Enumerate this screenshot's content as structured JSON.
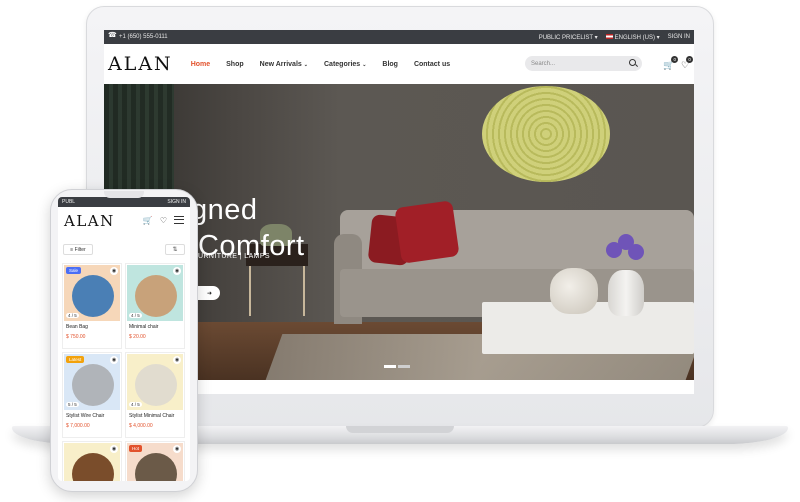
{
  "desktop": {
    "topbar": {
      "phone": "+1 (650) 555-0111",
      "pricelist": "PUBLIC PRICELIST",
      "language": "ENGLISH (US)",
      "signin": "SIGN IN"
    },
    "logo": "ALAN",
    "menu": [
      {
        "label": "Home",
        "active": true
      },
      {
        "label": "Shop"
      },
      {
        "label": "New Arrivals",
        "dropdown": true
      },
      {
        "label": "Categories",
        "dropdown": true
      },
      {
        "label": "Blog"
      },
      {
        "label": "Contact us"
      }
    ],
    "search_placeholder": "Search...",
    "cart_count": "0",
    "wishlist_count": "0",
    "hero": {
      "title_line1": "Designed",
      "title_line2": "your Comfort",
      "subtitle": "URNITURE  |  LAMPS",
      "slide_count": 2,
      "active_slide": 1
    }
  },
  "mobile": {
    "topbar_left": "PUBL",
    "topbar_right": "SIGN IN",
    "logo": "ALAN",
    "cart_count": "0",
    "wishlist_count": "0",
    "filter_label": "Filter",
    "products": [
      {
        "name": "Bean Bag",
        "price": "$ 750.00",
        "rating": "4 / 5",
        "badge": "Sale",
        "badge_color": "#4b6ef5",
        "bg": "#f6d7b9",
        "blob": "#4a7fb5"
      },
      {
        "name": "Minimal chair",
        "price": "$ 20.00",
        "rating": "4 / 5",
        "badge": "",
        "badge_color": "",
        "bg": "#bfe5df",
        "blob": "#c8a27a"
      },
      {
        "name": "Stylist Wire Chair",
        "price": "$ 7,000.00",
        "rating": "5 / 5",
        "badge": "Latest",
        "badge_color": "#f2a20c",
        "bg": "#d9e7f6",
        "blob": "#b0b4b9"
      },
      {
        "name": "Stylist Minimal Chair",
        "price": "$ 4,000.00",
        "rating": "4 / 5",
        "badge": "",
        "badge_color": "",
        "bg": "#f8efc9",
        "blob": "#e1dccf"
      },
      {
        "name": "",
        "price": "",
        "rating": "",
        "badge": "",
        "badge_color": "",
        "bg": "#f8efc9",
        "blob": "#7a4d2b"
      },
      {
        "name": "",
        "price": "",
        "rating": "",
        "badge": "Hot",
        "badge_color": "#e2522c",
        "bg": "#f6dccb",
        "blob": "#6b5a48"
      }
    ]
  }
}
